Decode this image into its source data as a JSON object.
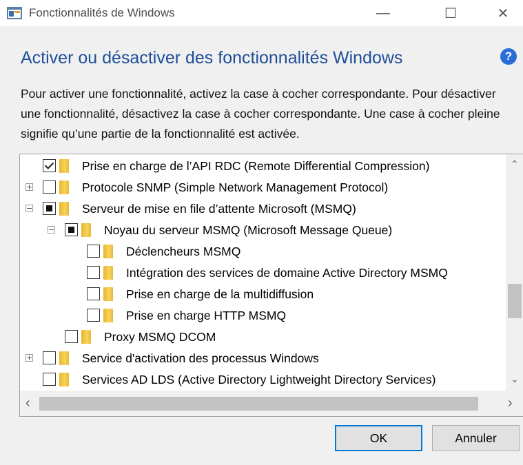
{
  "window": {
    "title": "Fonctionnalités de Windows",
    "minimize": "—",
    "maximize": "☐",
    "close": "✕"
  },
  "heading": "Activer ou désactiver des fonctionnalités Windows",
  "help": "?",
  "description": "Pour activer une fonctionnalité, activez la case à cocher correspondante. Pour désactiver une fonctionnalité, désactivez la case à cocher correspondante. Une case à cocher pleine signifie qu’une partie de la fonctionnalité est activée.",
  "features": [
    {
      "label": "Prise en charge de l’API RDC (Remote Differential Compression)",
      "state": "checked",
      "expander": "none"
    },
    {
      "label": "Protocole SNMP (Simple Network Management Protocol)",
      "state": "unchecked",
      "expander": "+"
    },
    {
      "label": "Serveur de mise en file d’attente Microsoft (MSMQ)",
      "state": "partial",
      "expander": "−"
    },
    {
      "label": "Noyau du serveur MSMQ (Microsoft Message Queue)",
      "state": "partial",
      "expander": "−"
    },
    {
      "label": "Déclencheurs MSMQ",
      "state": "unchecked",
      "expander": "none"
    },
    {
      "label": "Intégration des services de domaine Active Directory MSMQ",
      "state": "unchecked",
      "expander": "none"
    },
    {
      "label": "Prise en charge de la multidiffusion",
      "state": "unchecked",
      "expander": "none"
    },
    {
      "label": "Prise en charge HTTP MSMQ",
      "state": "unchecked",
      "expander": "none"
    },
    {
      "label": "Proxy MSMQ DCOM",
      "state": "unchecked",
      "expander": "none"
    },
    {
      "label": "Service d'activation des processus Windows",
      "state": "unchecked",
      "expander": "+"
    },
    {
      "label": "Services AD LDS (Active Directory Lightweight Directory Services)",
      "state": "unchecked",
      "expander": "none"
    }
  ],
  "scroll": {
    "up": "⌃",
    "down": "⌄",
    "left": "‹",
    "right": "›"
  },
  "buttons": {
    "ok": "OK",
    "cancel": "Annuler"
  }
}
